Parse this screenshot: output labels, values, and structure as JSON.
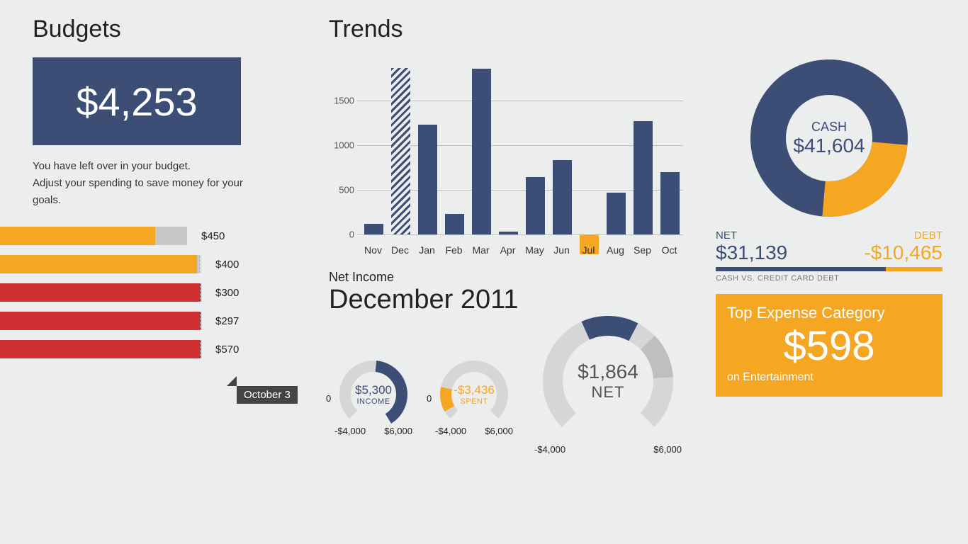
{
  "budgets": {
    "title": "Budgets",
    "amount": "$4,253",
    "line1": "You have left over in your budget.",
    "line2": "Adjust your spending to save money for your goals.",
    "date_tag": "October 3",
    "bars": [
      {
        "label": "$450",
        "track_w": 310,
        "fill_w": 265,
        "tick_x": 328,
        "color": "orange"
      },
      {
        "label": "$400",
        "track_w": 330,
        "fill_w": 324,
        "tick_x": 328,
        "color": "orange"
      },
      {
        "label": "$300",
        "track_w": 330,
        "fill_w": 330,
        "tick_x": 328,
        "color": "red"
      },
      {
        "label": "$297",
        "track_w": 330,
        "fill_w": 330,
        "tick_x": 328,
        "color": "red"
      },
      {
        "label": "$570",
        "track_w": 330,
        "fill_w": 330,
        "tick_x": 328,
        "color": "red"
      }
    ]
  },
  "trends": {
    "title": "Trends",
    "net_income_label": "Net Income",
    "month": "December 2011",
    "gauges": {
      "income": {
        "amount": "$5,300",
        "sub": "INCOME",
        "min": "-$4,000",
        "max": "$6,000",
        "zero": "0"
      },
      "spent": {
        "amount": "-$3,436",
        "sub": "SPENT",
        "min": "-$4,000",
        "max": "$6,000",
        "zero": "0"
      },
      "net": {
        "amount": "$1,864",
        "sub": "NET",
        "min": "-$4,000",
        "max": "$6,000"
      }
    }
  },
  "cash": {
    "label": "CASH",
    "value": "$41,604",
    "net_label": "NET",
    "net_value": "$31,139",
    "debt_label": "DEBT",
    "debt_value": "-$10,465",
    "caption": "CASH VS. CREDIT CARD DEBT",
    "top_expense": {
      "title": "Top Expense Category",
      "amount": "$598",
      "sub": "on Entertainment"
    }
  },
  "chart_data": [
    {
      "type": "bar",
      "title": "Net Income (monthly)",
      "categories": [
        "Nov",
        "Dec",
        "Jan",
        "Feb",
        "Mar",
        "Apr",
        "May",
        "Jun",
        "Jul",
        "Aug",
        "Sep",
        "Oct"
      ],
      "values": [
        120,
        1864,
        1230,
        230,
        1850,
        30,
        640,
        830,
        -220,
        470,
        1270,
        700
      ],
      "ylim": [
        -300,
        1900
      ],
      "yticks": [
        0,
        500,
        1000,
        1500
      ],
      "xlabel": "",
      "ylabel": ""
    },
    {
      "type": "pie",
      "title": "Cash vs Debt",
      "series": [
        {
          "name": "Cash",
          "value": 41604
        },
        {
          "name": "Debt",
          "value": 10465
        }
      ]
    }
  ]
}
